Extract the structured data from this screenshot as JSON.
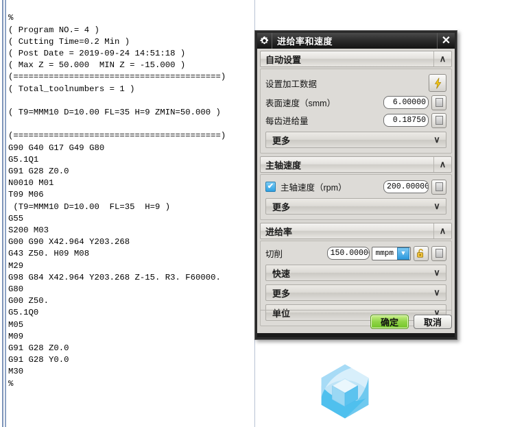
{
  "gcode": {
    "content": "%\n( Program NO.= 4 )\n( Cutting Time=0.2 Min )\n( Post Date = 2019-09-24 14:51:18 )\n( Max Z = 50.000  MIN Z = -15.000 )\n(=========================================)\n( Total_toolnumbers = 1 )\n\n( T9=MMM10 D=10.00 FL=35 H=9 ZMIN=50.000 )\n\n(=========================================)\nG90 G40 G17 G49 G80\nG5.1Q1\nG91 G28 Z0.0\nN0010 M01\nT09 M06\n (T9=MMM10 D=10.00  FL=35  H=9 )\nG55\nS200 M03\nG00 G90 X42.964 Y203.268\nG43 Z50. H09 M08\nM29\nG98 G84 X42.964 Y203.268 Z-15. R3. F60000.\nG80\nG00 Z50.\nG5.1Q0\nM05\nM09\nG91 G28 Z0.0\nG91 G28 Y0.0\nM30\n%"
  },
  "dialog": {
    "title": "进给率和速度",
    "icon": "gear-icon",
    "close_label": "✕",
    "groups": [
      {
        "id": "auto_settings",
        "title": "自动设置",
        "expanded": true,
        "chevron": "∧",
        "machining_data_label": "设置加工数据",
        "machining_data_button_icon": "lightning-bolt-icon",
        "fields": [
          {
            "label": "表面速度（smm）",
            "value": "6.00000",
            "side_button_icon": "page-icon"
          },
          {
            "label": "每齿进给量",
            "value": "0.18750",
            "side_button_icon": "page-icon"
          }
        ],
        "more_label": "更多",
        "more_chevron": "∨"
      },
      {
        "id": "spindle_speed",
        "title": "主轴速度",
        "expanded": true,
        "chevron": "∧",
        "checkbox_checked": true,
        "checkbox_label": "主轴速度（rpm）",
        "value": "200.00000",
        "side_button_icon": "page-icon",
        "more_label": "更多",
        "more_chevron": "∨"
      },
      {
        "id": "feed_rate",
        "title": "进给率",
        "expanded": true,
        "chevron": "∧",
        "cutting_label": "切削",
        "cutting_value": "150.00000",
        "unit_value": "mmpm",
        "unit_arrow": "▼",
        "lock_icon": "unlocked-padlock-icon",
        "side_button_icon": "page-icon",
        "sub_sections": [
          {
            "label": "快速",
            "chevron": "∨"
          },
          {
            "label": "更多",
            "chevron": "∨"
          },
          {
            "label": "单位",
            "chevron": "∨"
          }
        ]
      }
    ],
    "footer": {
      "ok_label": "确定",
      "cancel_label": "取消"
    }
  },
  "logo": {
    "name": "hexagon-cube-logo",
    "colors": {
      "light": "#bfe4f7",
      "mid": "#7fd0f2",
      "dark": "#4fc0ee"
    }
  },
  "colors": {
    "accent_blue": "#2ea0e2",
    "primary_green": "#8fd446",
    "titlebar_dark": "#2b2b2b",
    "panel_grey": "#d9d7d3"
  }
}
